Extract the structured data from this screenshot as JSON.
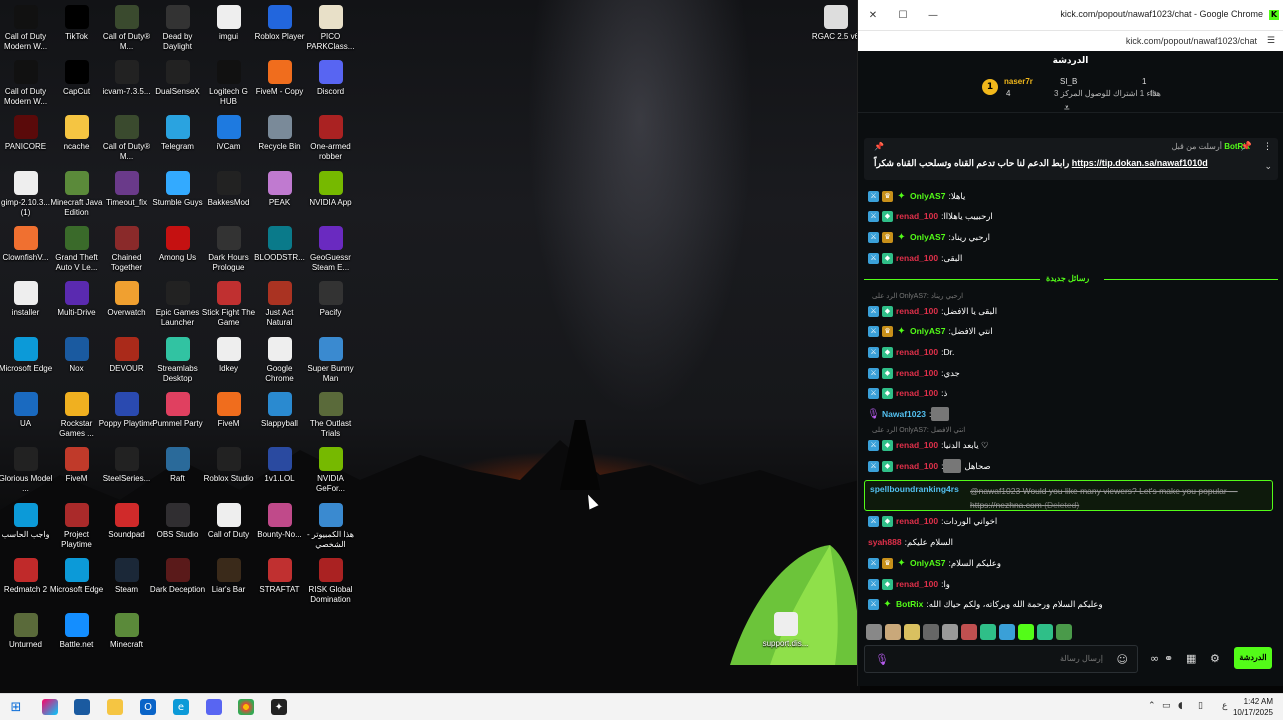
{
  "desktop": {
    "icons": [
      {
        "label": "Call of Duty Modern W...",
        "icon": "cod-icon",
        "color": "#111"
      },
      {
        "label": "TikTok",
        "icon": "tiktok-icon",
        "color": "#000"
      },
      {
        "label": "Call of Duty® M...",
        "icon": "mw-icon",
        "color": "#3a4a2e"
      },
      {
        "label": "Dead by Daylight",
        "icon": "dbd-icon",
        "color": "#333"
      },
      {
        "label": "imgui",
        "icon": "file-icon",
        "color": "#eee"
      },
      {
        "label": "Roblox Player",
        "icon": "roblox-icon",
        "color": "#2266dd"
      },
      {
        "label": "PICO PARKClass...",
        "icon": "pico-icon",
        "color": "#e8e0c8"
      },
      {
        "label": "Call of Duty Modern W...",
        "icon": "cod-icon",
        "color": "#111"
      },
      {
        "label": "CapCut",
        "icon": "capcut-icon",
        "color": "#000"
      },
      {
        "label": "icvam-7.3.5...",
        "icon": "icam-icon",
        "color": "#222"
      },
      {
        "label": "DualSenseX",
        "icon": "dualsense-icon",
        "color": "#222"
      },
      {
        "label": "Logitech G HUB",
        "icon": "logitech-icon",
        "color": "#111"
      },
      {
        "label": "FiveM - Copy",
        "icon": "fivem-icon",
        "color": "#f06d1d"
      },
      {
        "label": "Discord",
        "icon": "discord-icon",
        "color": "#5865f2"
      },
      {
        "label": "PANICORE",
        "icon": "panicore-icon",
        "color": "#5a0a0a"
      },
      {
        "label": "ncache",
        "icon": "folder-icon",
        "color": "#f5c542"
      },
      {
        "label": "Call of Duty® M...",
        "icon": "mw-icon",
        "color": "#3a4a2e"
      },
      {
        "label": "Telegram",
        "icon": "telegram-icon",
        "color": "#2aa3e0"
      },
      {
        "label": "iVCam",
        "icon": "ivcam-icon",
        "color": "#1e7ae0"
      },
      {
        "label": "Recycle Bin",
        "icon": "recycle-bin-icon",
        "color": "#7a8a99"
      },
      {
        "label": "One-armed robber",
        "icon": "slot-icon",
        "color": "#aa2222"
      },
      {
        "label": "gimp-2.10.3... (1)",
        "icon": "file-icon",
        "color": "#eee"
      },
      {
        "label": "Minecraft Java Edition",
        "icon": "minecraft-icon",
        "color": "#5b8a3a"
      },
      {
        "label": "Timeout_fix",
        "icon": "timeout-icon",
        "color": "#6a3a8a"
      },
      {
        "label": "Stumble Guys",
        "icon": "stumble-icon",
        "color": "#33aaff"
      },
      {
        "label": "BakkesMod",
        "icon": "bakkes-icon",
        "color": "#222"
      },
      {
        "label": "PEAK",
        "icon": "peak-icon",
        "color": "#c07ad0"
      },
      {
        "label": "NVIDIA App",
        "icon": "nvidia-icon",
        "color": "#76b900"
      },
      {
        "label": "ClownfishV...",
        "icon": "clownfish-icon",
        "color": "#f07030"
      },
      {
        "label": "Grand Theft Auto V Le...",
        "icon": "gta-icon",
        "color": "#3a6a2a"
      },
      {
        "label": "Chained Together",
        "icon": "chained-icon",
        "color": "#8a2a2a"
      },
      {
        "label": "Among Us",
        "icon": "amongus-icon",
        "color": "#c51111"
      },
      {
        "label": "Dark Hours Prologue",
        "icon": "darkhours-icon",
        "color": "#333"
      },
      {
        "label": "BLOODSTR...",
        "icon": "bloodstrike-icon",
        "color": "#0a7a8a"
      },
      {
        "label": "GeoGuessr Steam E...",
        "icon": "geoguessr-icon",
        "color": "#6a2ac0"
      },
      {
        "label": "installer",
        "icon": "file-icon",
        "color": "#eee"
      },
      {
        "label": "Multi-Drive",
        "icon": "multidrive-icon",
        "color": "#5a2ab0"
      },
      {
        "label": "Overwatch",
        "icon": "overwatch-icon",
        "color": "#f0a030"
      },
      {
        "label": "Epic Games Launcher",
        "icon": "epic-icon",
        "color": "#222"
      },
      {
        "label": "Stick Fight The Game",
        "icon": "stickfight-icon",
        "color": "#c03030"
      },
      {
        "label": "Just Act Natural",
        "icon": "jan-icon",
        "color": "#aa3322"
      },
      {
        "label": "Pacify",
        "icon": "pacify-icon",
        "color": "#333"
      },
      {
        "label": "Microsoft Edge",
        "icon": "edge-icon",
        "color": "#0c9ad8"
      },
      {
        "label": "Nox",
        "icon": "nox-icon",
        "color": "#1a5aa0"
      },
      {
        "label": "DEVOUR",
        "icon": "devour-icon",
        "color": "#aa2a1a"
      },
      {
        "label": "Streamlabs Desktop",
        "icon": "streamlabs-icon",
        "color": "#31c3a2"
      },
      {
        "label": "Idkey",
        "icon": "file-icon",
        "color": "#eee"
      },
      {
        "label": "Google Chrome",
        "icon": "file-icon",
        "color": "#eee"
      },
      {
        "label": "Super Bunny Man",
        "icon": "bunny-icon",
        "color": "#3a8ad0"
      },
      {
        "label": "UA",
        "icon": "ua-icon",
        "color": "#1a6ac0"
      },
      {
        "label": "Rockstar Games ...",
        "icon": "rockstar-icon",
        "color": "#f0b020"
      },
      {
        "label": "Poppy Playtime",
        "icon": "poppy-icon",
        "color": "#2a4ab0"
      },
      {
        "label": "Pummel Party",
        "icon": "pummel-icon",
        "color": "#e04060"
      },
      {
        "label": "FiveM",
        "icon": "fivem-icon",
        "color": "#f06d1d"
      },
      {
        "label": "Slappyball",
        "icon": "slappy-icon",
        "color": "#2a8ad0"
      },
      {
        "label": "The Outlast Trials",
        "icon": "outlast-icon",
        "color": "#5a6a3a"
      },
      {
        "label": "Glorious Model ...",
        "icon": "glorious-icon",
        "color": "#222"
      },
      {
        "label": "FiveM",
        "icon": "fivem-icon",
        "color": "#c03a2a"
      },
      {
        "label": "SteelSeries...",
        "icon": "steelseries-icon",
        "color": "#222"
      },
      {
        "label": "Raft",
        "icon": "raft-icon",
        "color": "#2a6a9a"
      },
      {
        "label": "Roblox Studio",
        "icon": "roblox-studio-icon",
        "color": "#222"
      },
      {
        "label": "1v1.LOL",
        "icon": "1v1-icon",
        "color": "#2a4aa0"
      },
      {
        "label": "NVIDIA GeFor...",
        "icon": "geforce-icon",
        "color": "#76b900"
      },
      {
        "label": "واجب الحاسب",
        "icon": "edge-icon",
        "color": "#0c9ad8"
      },
      {
        "label": "Project Playtime",
        "icon": "project-playtime-icon",
        "color": "#aa2a2a"
      },
      {
        "label": "Soundpad",
        "icon": "soundpad-icon",
        "color": "#d02a2a"
      },
      {
        "label": "OBS Studio",
        "icon": "obs-icon",
        "color": "#302e31"
      },
      {
        "label": "Call of Duty",
        "icon": "file-icon",
        "color": "#eee"
      },
      {
        "label": "Bounty-No...",
        "icon": "bounty-icon",
        "color": "#c04a8a"
      },
      {
        "label": "هذا الكمبيوتر - الشخصي",
        "icon": "this-pc-icon",
        "color": "#3a8ad0"
      },
      {
        "label": "Redmatch 2",
        "icon": "redmatch-icon",
        "color": "#c02a2a"
      },
      {
        "label": "Microsoft Edge",
        "icon": "edge-icon",
        "color": "#0c9ad8"
      },
      {
        "label": "Steam",
        "icon": "steam-icon",
        "color": "#1b2838"
      },
      {
        "label": "Dark Deception",
        "icon": "dark-deception-icon",
        "color": "#5a1a1a"
      },
      {
        "label": "Liar's Bar",
        "icon": "liars-bar-icon",
        "color": "#3a2a1a"
      },
      {
        "label": "STRAFTAT",
        "icon": "straftat-icon",
        "color": "#c03030"
      },
      {
        "label": "RISK Global Domination",
        "icon": "risk-icon",
        "color": "#aa2222"
      },
      {
        "label": "Unturned",
        "icon": "unturned-icon",
        "color": "#5a6a3a"
      },
      {
        "label": "Battle.net",
        "icon": "battlenet-icon",
        "color": "#148eff"
      },
      {
        "label": "Minecraft",
        "icon": "minecraft-icon",
        "color": "#5b8a3a"
      }
    ],
    "extra_icons": [
      {
        "label": "RGAC 2.5 v6",
        "icon": "rgac-icon",
        "color": "#ddd"
      },
      {
        "label": "support.dis...",
        "icon": "file-icon",
        "color": "#eee"
      }
    ]
  },
  "chrome": {
    "title": "kick.com/popout/nawaf1023/chat - Google Chrome",
    "url": "kick.com/popout/nawaf1023/chat",
    "window_buttons": {
      "close": "✕",
      "restore": "☐",
      "minimize": "—"
    }
  },
  "chat": {
    "header": "الدردشة",
    "leaderboard": {
      "rank": "1",
      "user1": "naser7r",
      "user1_count": "4",
      "user2": "SI_B",
      "user2_note": "هداء 1 اشتراك للوصول المركز 3",
      "user2_rank": "th",
      "count_right": "1"
    },
    "pinned": {
      "header": "أرسلت من قبل",
      "author": "BotRix",
      "text": "رابط الدعم لنا حاب تدعم القناه وتسلحب القناه شكراً",
      "link": "https://tip.dokan.sa/nawaf1010d"
    },
    "messages_top": [
      {
        "user": "OnlyAS7",
        "color": "#53fc18",
        "text": "ياهلا",
        "badges": [
          "mod",
          "crown",
          "vip"
        ]
      },
      {
        "user": "renad_100",
        "color": "#e0304a",
        "text": "ارحبييب ياهلااا",
        "badges": [
          "mod",
          "sub"
        ]
      },
      {
        "user": "OnlyAS7",
        "color": "#53fc18",
        "text": "ارحبي ريناد",
        "badges": [
          "mod",
          "crown",
          "vip"
        ]
      },
      {
        "user": "renad_100",
        "color": "#e0304a",
        "text": "البقى",
        "badges": [
          "mod",
          "sub"
        ]
      }
    ],
    "new_messages_label": "رسائل جديدة",
    "messages": [
      {
        "reply": "الرد على OnlyAS7: ارحبي ريناد",
        "user": "renad_100",
        "color": "#e0304a",
        "text": "البقى يا الافضل",
        "badges": [
          "mod",
          "sub"
        ]
      },
      {
        "user": "OnlyAS7",
        "color": "#53fc18",
        "text": "انتي الافضل",
        "badges": [
          "mod",
          "crown",
          "vip"
        ]
      },
      {
        "user": "renad_100",
        "color": "#e0304a",
        "text": "Dr.",
        "badges": [
          "mod",
          "sub"
        ]
      },
      {
        "user": "renad_100",
        "color": "#e0304a",
        "text": "جدي",
        "badges": [
          "mod",
          "sub"
        ]
      },
      {
        "user": "renad_100",
        "color": "#e0304a",
        "text": "ذ",
        "badges": [
          "mod",
          "sub"
        ]
      },
      {
        "user": "Nawaf1023",
        "color": "#53c0f0",
        "text": "",
        "badges": [
          "mic"
        ],
        "emote": true
      },
      {
        "reply": "الرد على OnlyAS7: انتي الافضل",
        "user": "renad_100",
        "color": "#e0304a",
        "text": "يابعد الدنيا ♡",
        "badges": [
          "mod",
          "sub"
        ]
      },
      {
        "user": "renad_100",
        "color": "#e0304a",
        "text": "صحاهل",
        "badges": [
          "mod",
          "sub"
        ],
        "emote": true
      }
    ],
    "highlight": {
      "user": "spellboundranking4rs",
      "text": "@nawaf1023 Would you like many viewers? Let's make you popular — https://nezhna.com",
      "deleted": "(Deleted)"
    },
    "messages_bottom": [
      {
        "user": "renad_100",
        "color": "#e0304a",
        "text": "اخواني الوردات",
        "badges": [
          "mod",
          "sub"
        ]
      },
      {
        "user": "syah888",
        "color": "#e0304a",
        "text": "السلام عليكم",
        "badges": []
      },
      {
        "user": "OnlyAS7",
        "color": "#53fc18",
        "text": "وعليكم السلام",
        "badges": [
          "mod",
          "crown",
          "vip"
        ]
      },
      {
        "user": "renad_100",
        "color": "#e0304a",
        "text": "وا",
        "badges": [
          "mod",
          "sub"
        ]
      },
      {
        "user": "BotRix",
        "color": "#53fc18",
        "text": "وعليكم السلام ورحمة الله وبركاته، ولكم حياك الله",
        "badges": [
          "mod",
          "vip"
        ]
      }
    ],
    "input_placeholder": "إرسال رسالة",
    "send_label": "الدردشة"
  },
  "taskbar": {
    "time": "1:42 AM",
    "date": "10/17/2025",
    "lang": "ع"
  }
}
